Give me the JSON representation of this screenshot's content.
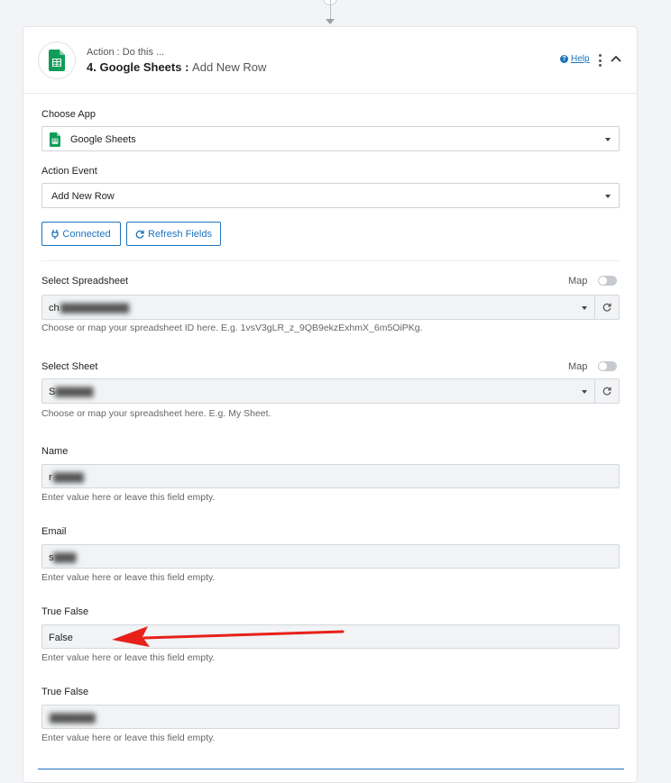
{
  "step": {
    "subtitle": "Action : Do this ...",
    "title": "4. Google Sheets :",
    "event": "Add New Row",
    "help_label": "Help",
    "app_icon": "google-sheets-icon"
  },
  "choose_app": {
    "label": "Choose App",
    "value": "Google Sheets"
  },
  "action_event": {
    "label": "Action Event",
    "value": "Add New Row"
  },
  "buttons": {
    "connected": "Connected",
    "refresh_fields": "Refresh Fields"
  },
  "spreadsheet": {
    "label": "Select Spreadsheet",
    "map_label": "Map",
    "value": "ch",
    "hint": "Choose or map your spreadsheet ID here. E.g. 1vsV3gLR_z_9QB9ekzExhmX_6m5OiPKg."
  },
  "sheet": {
    "label": "Select Sheet",
    "map_label": "Map",
    "value": "S",
    "hint": "Choose or map your spreadsheet here. E.g. My Sheet."
  },
  "fields": [
    {
      "label": "Name",
      "value": "r",
      "hint": "Enter value here or leave this field empty."
    },
    {
      "label": "Email",
      "value": "s",
      "hint": "Enter value here or leave this field empty."
    },
    {
      "label": "True False",
      "value": "False",
      "hint": "Enter value here or leave this field empty."
    },
    {
      "label": "True False",
      "value": "",
      "hint": "Enter value here or leave this field empty."
    }
  ],
  "colors": {
    "accent": "#1e73be",
    "sheets_green": "#0f9d58",
    "annotation": "#e8201a"
  }
}
